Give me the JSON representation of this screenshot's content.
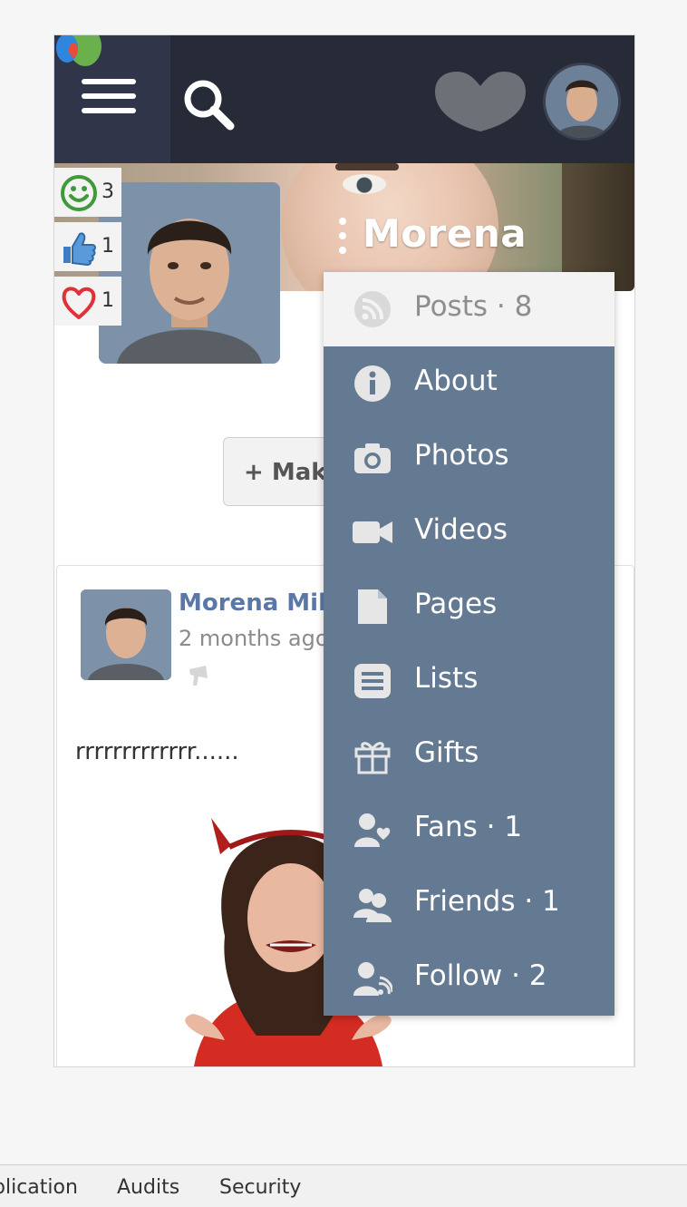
{
  "header": {
    "menu_icon": "hamburger-icon",
    "search_icon": "search-icon",
    "notification_icon": "heart-icon",
    "avatar": "user-avatar"
  },
  "profile": {
    "cover_name": "Morena",
    "reactions": [
      {
        "icon": "smile-icon",
        "count": "3",
        "color": "#3f9a3a"
      },
      {
        "icon": "thumbs-up-icon",
        "count": "1",
        "color": "#3d7dc2"
      },
      {
        "icon": "heart-outline-icon",
        "count": "1",
        "color": "#e0303a"
      }
    ],
    "make_button_label": "+ Make Friends"
  },
  "post": {
    "author": "Morena Miller",
    "time": "2 months ago",
    "text": "rrrrrrrrrrrrr......",
    "promo_icon": "megaphone-icon"
  },
  "dropdown": {
    "items": [
      {
        "label": "Posts · 8",
        "icon": "rss-icon",
        "active": true
      },
      {
        "label": "About",
        "icon": "info-icon"
      },
      {
        "label": "Photos",
        "icon": "camera-icon"
      },
      {
        "label": "Videos",
        "icon": "video-icon"
      },
      {
        "label": "Pages",
        "icon": "file-icon"
      },
      {
        "label": "Lists",
        "icon": "list-icon"
      },
      {
        "label": "Gifts",
        "icon": "gift-icon"
      },
      {
        "label": "Fans · 1",
        "icon": "fans-icon"
      },
      {
        "label": "Friends · 1",
        "icon": "friends-icon"
      },
      {
        "label": "Follow · 2",
        "icon": "follow-icon"
      }
    ]
  },
  "devtools": {
    "tabs": [
      "plication",
      "Audits",
      "Security"
    ]
  },
  "colors": {
    "topbar": "#272a37",
    "menu_bg": "#647a92",
    "author_link": "#5a77a7"
  }
}
